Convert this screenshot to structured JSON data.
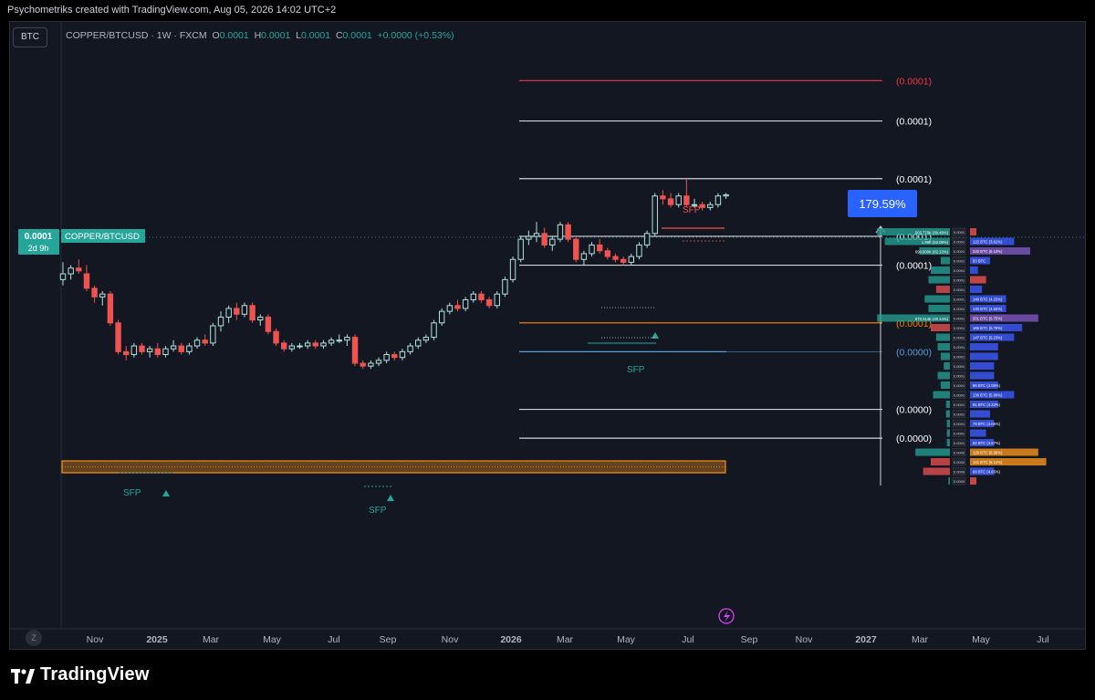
{
  "header": {
    "attribution": "Psychometriks created with TradingView.com, Aug 05, 2026 14:02 UTC+2"
  },
  "symbol_box": "BTC",
  "legend": {
    "symbol_line": "COPPER/BTCUSD · 1W · FXCM",
    "o_label": "O",
    "o_value": "0.0001",
    "h_label": "H",
    "h_value": "0.0001",
    "l_label": "L",
    "l_value": "0.0001",
    "c_label": "C",
    "c_value": "0.0001",
    "change": "+0.0000 (+0.53%)"
  },
  "price_tag": {
    "value": "0.0001",
    "countdown": "2d 9h",
    "symbol": "COPPER/BTCUSD"
  },
  "measure_badge": "179.59%",
  "footer": {
    "logo_text": "TradingView",
    "zoom_button": "Z"
  },
  "colors": {
    "background": "#131722",
    "up": "#26a69a",
    "down": "#ef5350",
    "orange": "#f7931a",
    "blue_badge": "#2962ff"
  },
  "chart_data": {
    "type": "candlestick",
    "title": "COPPER/BTCUSD",
    "interval": "1W",
    "exchange": "FXCM",
    "x_ticks": [
      "Nov",
      "2025",
      "Mar",
      "May",
      "Jul",
      "Sep",
      "Nov",
      "2026",
      "Mar",
      "May",
      "Jul",
      "Sep",
      "Nov",
      "2027",
      "Mar",
      "May",
      "Jul"
    ],
    "levels": [
      {
        "label": "(0.0001)",
        "color": "#f23645",
        "y": 99
      },
      {
        "label": "(0.0001)",
        "color": "#d1d4dc",
        "y": 92
      },
      {
        "label": "(0.0001)",
        "color": "#d1d4dc",
        "y": 82
      },
      {
        "label": "(0.0001)",
        "color": "#d1d4dc",
        "y": 72
      },
      {
        "label": "(0.0001)",
        "color": "#d1d4dc",
        "y": 67
      },
      {
        "label": "(0.0001)",
        "color": "#f57c00",
        "y": 57
      },
      {
        "label": "(0.0000)",
        "color": "#5b9bd5",
        "y": 52
      },
      {
        "label": "(0.0000)",
        "color": "#d1d4dc",
        "y": 42
      },
      {
        "label": "(0.0000)",
        "color": "#d1d4dc",
        "y": 37
      }
    ],
    "annotations": [
      "SFP",
      "SFP",
      "SFP",
      "SFP"
    ],
    "candles": [
      {
        "o": 64.5,
        "h": 67.5,
        "l": 63.5,
        "c": 65.5
      },
      {
        "o": 65.5,
        "h": 67.0,
        "l": 64.5,
        "c": 66.5
      },
      {
        "o": 66.5,
        "h": 68.0,
        "l": 65.5,
        "c": 66.0
      },
      {
        "o": 65.5,
        "h": 67.0,
        "l": 62.5,
        "c": 63.0
      },
      {
        "o": 63.0,
        "h": 63.5,
        "l": 60.5,
        "c": 61.5
      },
      {
        "o": 61.5,
        "h": 62.5,
        "l": 60.0,
        "c": 62.0
      },
      {
        "o": 62.0,
        "h": 62.5,
        "l": 56.5,
        "c": 57.0
      },
      {
        "o": 57.0,
        "h": 57.5,
        "l": 51.5,
        "c": 52.0
      },
      {
        "o": 52.0,
        "h": 53.0,
        "l": 50.5,
        "c": 51.5
      },
      {
        "o": 51.5,
        "h": 53.5,
        "l": 51.0,
        "c": 53.0
      },
      {
        "o": 53.0,
        "h": 53.5,
        "l": 51.5,
        "c": 52.0
      },
      {
        "o": 52.0,
        "h": 53.0,
        "l": 51.0,
        "c": 52.5
      },
      {
        "o": 52.5,
        "h": 53.5,
        "l": 51.0,
        "c": 51.5
      },
      {
        "o": 51.5,
        "h": 53.0,
        "l": 51.0,
        "c": 52.5
      },
      {
        "o": 52.5,
        "h": 54.0,
        "l": 52.0,
        "c": 53.0
      },
      {
        "o": 53.0,
        "h": 53.5,
        "l": 51.5,
        "c": 52.0
      },
      {
        "o": 52.0,
        "h": 53.5,
        "l": 51.5,
        "c": 53.0
      },
      {
        "o": 53.0,
        "h": 54.5,
        "l": 52.5,
        "c": 54.0
      },
      {
        "o": 54.0,
        "h": 55.0,
        "l": 53.0,
        "c": 53.5
      },
      {
        "o": 53.5,
        "h": 57.0,
        "l": 53.0,
        "c": 56.5
      },
      {
        "o": 56.5,
        "h": 59.0,
        "l": 55.5,
        "c": 58.0
      },
      {
        "o": 58.0,
        "h": 60.0,
        "l": 57.0,
        "c": 59.5
      },
      {
        "o": 59.5,
        "h": 60.5,
        "l": 57.5,
        "c": 58.5
      },
      {
        "o": 58.5,
        "h": 60.5,
        "l": 58.0,
        "c": 60.0
      },
      {
        "o": 60.0,
        "h": 60.5,
        "l": 57.0,
        "c": 57.5
      },
      {
        "o": 57.5,
        "h": 58.5,
        "l": 56.5,
        "c": 58.0
      },
      {
        "o": 58.0,
        "h": 58.5,
        "l": 55.0,
        "c": 55.5
      },
      {
        "o": 55.5,
        "h": 56.0,
        "l": 53.0,
        "c": 53.5
      },
      {
        "o": 53.5,
        "h": 54.0,
        "l": 52.0,
        "c": 52.5
      },
      {
        "o": 52.5,
        "h": 53.5,
        "l": 52.0,
        "c": 53.0
      },
      {
        "o": 53.0,
        "h": 53.5,
        "l": 52.5,
        "c": 53.0
      },
      {
        "o": 53.0,
        "h": 54.0,
        "l": 52.5,
        "c": 53.5
      },
      {
        "o": 53.5,
        "h": 54.0,
        "l": 52.5,
        "c": 53.0
      },
      {
        "o": 53.0,
        "h": 54.0,
        "l": 52.5,
        "c": 53.5
      },
      {
        "o": 53.5,
        "h": 54.5,
        "l": 53.0,
        "c": 54.0
      },
      {
        "o": 54.0,
        "h": 55.0,
        "l": 53.5,
        "c": 54.0
      },
      {
        "o": 54.0,
        "h": 55.0,
        "l": 53.0,
        "c": 54.5
      },
      {
        "o": 54.5,
        "h": 55.0,
        "l": 49.5,
        "c": 50.0
      },
      {
        "o": 50.0,
        "h": 50.5,
        "l": 49.0,
        "c": 49.5
      },
      {
        "o": 49.5,
        "h": 50.5,
        "l": 49.0,
        "c": 50.0
      },
      {
        "o": 50.0,
        "h": 51.0,
        "l": 49.5,
        "c": 50.5
      },
      {
        "o": 50.5,
        "h": 52.0,
        "l": 50.0,
        "c": 51.5
      },
      {
        "o": 51.5,
        "h": 52.0,
        "l": 50.5,
        "c": 51.0
      },
      {
        "o": 51.0,
        "h": 52.5,
        "l": 50.5,
        "c": 52.0
      },
      {
        "o": 52.0,
        "h": 53.5,
        "l": 51.5,
        "c": 53.0
      },
      {
        "o": 53.0,
        "h": 54.5,
        "l": 52.5,
        "c": 54.0
      },
      {
        "o": 54.0,
        "h": 55.0,
        "l": 53.5,
        "c": 54.5
      },
      {
        "o": 54.5,
        "h": 57.5,
        "l": 54.0,
        "c": 57.0
      },
      {
        "o": 57.0,
        "h": 59.5,
        "l": 56.5,
        "c": 59.0
      },
      {
        "o": 59.0,
        "h": 60.5,
        "l": 58.5,
        "c": 60.0
      },
      {
        "o": 60.0,
        "h": 61.0,
        "l": 59.0,
        "c": 59.5
      },
      {
        "o": 59.5,
        "h": 61.5,
        "l": 59.0,
        "c": 61.0
      },
      {
        "o": 61.0,
        "h": 62.5,
        "l": 60.5,
        "c": 62.0
      },
      {
        "o": 62.0,
        "h": 62.5,
        "l": 60.5,
        "c": 61.0
      },
      {
        "o": 61.0,
        "h": 61.5,
        "l": 59.5,
        "c": 60.0
      },
      {
        "o": 60.0,
        "h": 62.5,
        "l": 59.5,
        "c": 62.0
      },
      {
        "o": 62.0,
        "h": 65.0,
        "l": 61.5,
        "c": 64.5
      },
      {
        "o": 64.5,
        "h": 68.5,
        "l": 64.0,
        "c": 68.0
      },
      {
        "o": 68.0,
        "h": 72.0,
        "l": 67.5,
        "c": 71.5
      },
      {
        "o": 71.5,
        "h": 73.0,
        "l": 70.5,
        "c": 72.0
      },
      {
        "o": 72.0,
        "h": 74.5,
        "l": 71.0,
        "c": 72.5
      },
      {
        "o": 72.5,
        "h": 73.5,
        "l": 70.0,
        "c": 70.5
      },
      {
        "o": 70.5,
        "h": 72.0,
        "l": 69.5,
        "c": 71.5
      },
      {
        "o": 71.5,
        "h": 74.5,
        "l": 71.0,
        "c": 74.0
      },
      {
        "o": 74.0,
        "h": 74.5,
        "l": 71.0,
        "c": 71.5
      },
      {
        "o": 71.5,
        "h": 72.0,
        "l": 67.5,
        "c": 68.0
      },
      {
        "o": 68.0,
        "h": 69.5,
        "l": 67.0,
        "c": 69.0
      },
      {
        "o": 69.0,
        "h": 71.0,
        "l": 68.5,
        "c": 70.5
      },
      {
        "o": 70.5,
        "h": 71.5,
        "l": 69.0,
        "c": 69.5
      },
      {
        "o": 69.5,
        "h": 70.0,
        "l": 68.0,
        "c": 68.5
      },
      {
        "o": 68.5,
        "h": 69.0,
        "l": 67.5,
        "c": 68.0
      },
      {
        "o": 68.0,
        "h": 68.5,
        "l": 67.0,
        "c": 67.5
      },
      {
        "o": 67.5,
        "h": 69.0,
        "l": 67.0,
        "c": 68.5
      },
      {
        "o": 68.5,
        "h": 71.0,
        "l": 68.0,
        "c": 70.5
      },
      {
        "o": 70.5,
        "h": 73.0,
        "l": 70.0,
        "c": 72.5
      },
      {
        "o": 72.5,
        "h": 79.5,
        "l": 72.0,
        "c": 79.0
      },
      {
        "o": 79.0,
        "h": 80.0,
        "l": 77.5,
        "c": 78.5
      },
      {
        "o": 78.5,
        "h": 79.5,
        "l": 77.0,
        "c": 77.5
      },
      {
        "o": 77.5,
        "h": 79.5,
        "l": 77.0,
        "c": 79.0
      },
      {
        "o": 79.0,
        "h": 82.0,
        "l": 77.0,
        "c": 77.5
      },
      {
        "o": 77.5,
        "h": 78.5,
        "l": 77.0,
        "c": 77.5
      },
      {
        "o": 77.5,
        "h": 78.0,
        "l": 76.5,
        "c": 77.0
      },
      {
        "o": 77.0,
        "h": 78.0,
        "l": 76.5,
        "c": 77.5
      },
      {
        "o": 77.5,
        "h": 79.5,
        "l": 77.0,
        "c": 79.0
      },
      {
        "o": 79.0,
        "h": 79.5,
        "l": 78.5,
        "c": 79.2
      }
    ],
    "volume_profile": [
      {
        "left": {
          "label": "503.770K (89.49%)",
          "w": 0.95,
          "color": "#26a69a"
        },
        "center": "0.0001",
        "right": {
          "label": "",
          "w": 0.08,
          "color": "#ef5350"
        }
      },
      {
        "left": {
          "label": "1.96K (52.09%)",
          "w": 0.85,
          "color": "#26a69a"
        },
        "center": "0.0001",
        "right": {
          "label": "122 BTC (3.61%)",
          "w": 0.55,
          "color": "#3d5afe"
        }
      },
      {
        "left": {
          "label": "690.000K (82.13%)",
          "w": 0.4,
          "color": "#26a69a"
        },
        "center": "0.0001",
        "right": {
          "label": "220 BTC (6.13%)",
          "w": 0.75,
          "color": "#7e57c2"
        }
      },
      {
        "left": {
          "label": "",
          "w": 0.12,
          "color": "#26a69a"
        },
        "center": "0.0001",
        "right": {
          "label": "50 BTC",
          "w": 0.25,
          "color": "#3d5afe"
        }
      },
      {
        "left": {
          "label": "",
          "w": 0.25,
          "color": "#26a69a"
        },
        "center": "0.0001",
        "right": {
          "label": "",
          "w": 0.1,
          "color": "#3d5afe"
        }
      },
      {
        "left": {
          "label": "",
          "w": 0.28,
          "color": "#26a69a"
        },
        "center": "0.0001",
        "right": {
          "label": "",
          "w": 0.2,
          "color": "#ef5350"
        }
      },
      {
        "left": {
          "label": "",
          "w": 0.18,
          "color": "#ef5350"
        },
        "center": "0.0001",
        "right": {
          "label": "",
          "w": 0.15,
          "color": "#3d5afe"
        }
      },
      {
        "left": {
          "label": "",
          "w": 0.33,
          "color": "#26a69a"
        },
        "center": "0.0001",
        "right": {
          "label": "140 BTC (4.15%)",
          "w": 0.45,
          "color": "#3d5afe"
        }
      },
      {
        "left": {
          "label": "",
          "w": 0.28,
          "color": "#26a69a"
        },
        "center": "0.0001",
        "right": {
          "label": "140 BTC (4.55%)",
          "w": 0.45,
          "color": "#3d5afe"
        }
      },
      {
        "left": {
          "label": "970.314K (40.14%)",
          "w": 0.95,
          "color": "#26a69a"
        },
        "center": "0.0001",
        "right": {
          "label": "201 BTC (5.75%)",
          "w": 0.85,
          "color": "#7e57c2"
        }
      },
      {
        "left": {
          "label": "",
          "w": 0.25,
          "color": "#ef5350"
        },
        "center": "0.0001",
        "right": {
          "label": "166 BTC (5.76%)",
          "w": 0.65,
          "color": "#3d5afe"
        }
      },
      {
        "left": {
          "label": "",
          "w": 0.18,
          "color": "#26a69a"
        },
        "center": "0.0001",
        "right": {
          "label": "147 BTC (5.23%)",
          "w": 0.55,
          "color": "#3d5afe"
        }
      },
      {
        "left": {
          "label": "",
          "w": 0.16,
          "color": "#26a69a"
        },
        "center": "0.0001",
        "right": {
          "label": "",
          "w": 0.35,
          "color": "#3d5afe"
        }
      },
      {
        "left": {
          "label": "",
          "w": 0.12,
          "color": "#26a69a"
        },
        "center": "0.0001",
        "right": {
          "label": "",
          "w": 0.35,
          "color": "#3d5afe"
        }
      },
      {
        "left": {
          "label": "",
          "w": 0.08,
          "color": "#26a69a"
        },
        "center": "0.0001",
        "right": {
          "label": "",
          "w": 0.3,
          "color": "#3d5afe"
        }
      },
      {
        "left": {
          "label": "",
          "w": 0.16,
          "color": "#26a69a"
        },
        "center": "0.0001",
        "right": {
          "label": "",
          "w": 0.3,
          "color": "#3d5afe"
        }
      },
      {
        "left": {
          "label": "",
          "w": 0.12,
          "color": "#26a69a"
        },
        "center": "0.0001",
        "right": {
          "label": "96 BTC (4.06%)",
          "w": 0.35,
          "color": "#3d5afe"
        }
      },
      {
        "left": {
          "label": "",
          "w": 0.22,
          "color": "#26a69a"
        },
        "center": "0.0001",
        "right": {
          "label": "136 BTC (5.90%)",
          "w": 0.55,
          "color": "#3d5afe"
        }
      },
      {
        "left": {
          "label": "",
          "w": 0.05,
          "color": "#26a69a"
        },
        "center": "0.0001",
        "right": {
          "label": "91 BTC (4.22%)",
          "w": 0.35,
          "color": "#3d5afe"
        }
      },
      {
        "left": {
          "label": "",
          "w": 0.05,
          "color": "#26a69a"
        },
        "center": "0.0001",
        "right": {
          "label": "",
          "w": 0.25,
          "color": "#3d5afe"
        }
      },
      {
        "left": {
          "label": "",
          "w": 0.04,
          "color": "#26a69a"
        },
        "center": "0.0001",
        "right": {
          "label": "79 BTC (4.05%)",
          "w": 0.3,
          "color": "#3d5afe"
        }
      },
      {
        "left": {
          "label": "",
          "w": 0.04,
          "color": "#26a69a"
        },
        "center": "0.0001",
        "right": {
          "label": "",
          "w": 0.2,
          "color": "#3d5afe"
        }
      },
      {
        "left": {
          "label": "",
          "w": 0.04,
          "color": "#26a69a"
        },
        "center": "0.0001",
        "right": {
          "label": "82 BTC (4.67%)",
          "w": 0.3,
          "color": "#3d5afe"
        }
      },
      {
        "left": {
          "label": "",
          "w": 0.45,
          "color": "#26a69a"
        },
        "center": "0.0000",
        "right": {
          "label": "129 BTC (6.36%)",
          "w": 0.85,
          "color": "#f7931a"
        }
      },
      {
        "left": {
          "label": "",
          "w": 0.25,
          "color": "#ef5350"
        },
        "center": "0.0000",
        "right": {
          "label": "141 BTC (5.14%)",
          "w": 0.95,
          "color": "#f7931a"
        }
      },
      {
        "left": {
          "label": "",
          "w": 0.35,
          "color": "#ef5350"
        },
        "center": "0.0000",
        "right": {
          "label": "68 BTC (4.65%)",
          "w": 0.3,
          "color": "#3d5afe"
        }
      },
      {
        "left": {
          "label": "",
          "w": 0.02,
          "color": "#26a69a"
        },
        "center": "0.0000",
        "right": {
          "label": "",
          "w": 0.08,
          "color": "#ef5350"
        }
      }
    ]
  }
}
